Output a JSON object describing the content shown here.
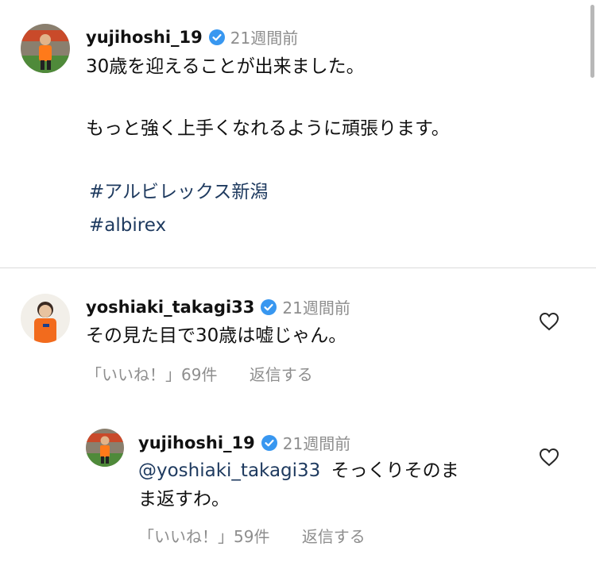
{
  "post": {
    "username": "yujihoshi_19",
    "time": "21週間前",
    "line1": "30歳を迎えることが出来ました。",
    "line2": "もっと強く上手くなれるように頑張ります。",
    "hashtag1": "#アルビレックス新潟",
    "hashtag2": "#albirex"
  },
  "comment": {
    "username": "yoshiaki_takagi33",
    "time": "21週間前",
    "text": "その見た目で30歳は嘘じゃん。",
    "likes": "「いいね！」69件",
    "reply_label": "返信する"
  },
  "reply": {
    "username": "yujihoshi_19",
    "time": "21週間前",
    "mention": "@yoshiaki_takagi33",
    "text_rest": "そっくりそのま",
    "text_line2": "ま返すわ。",
    "likes": "「いいね！」59件",
    "reply_label": "返信する"
  },
  "colors": {
    "verified": "#3897f0",
    "muted": "#8e8e8e",
    "link": "#1e3a5f"
  }
}
